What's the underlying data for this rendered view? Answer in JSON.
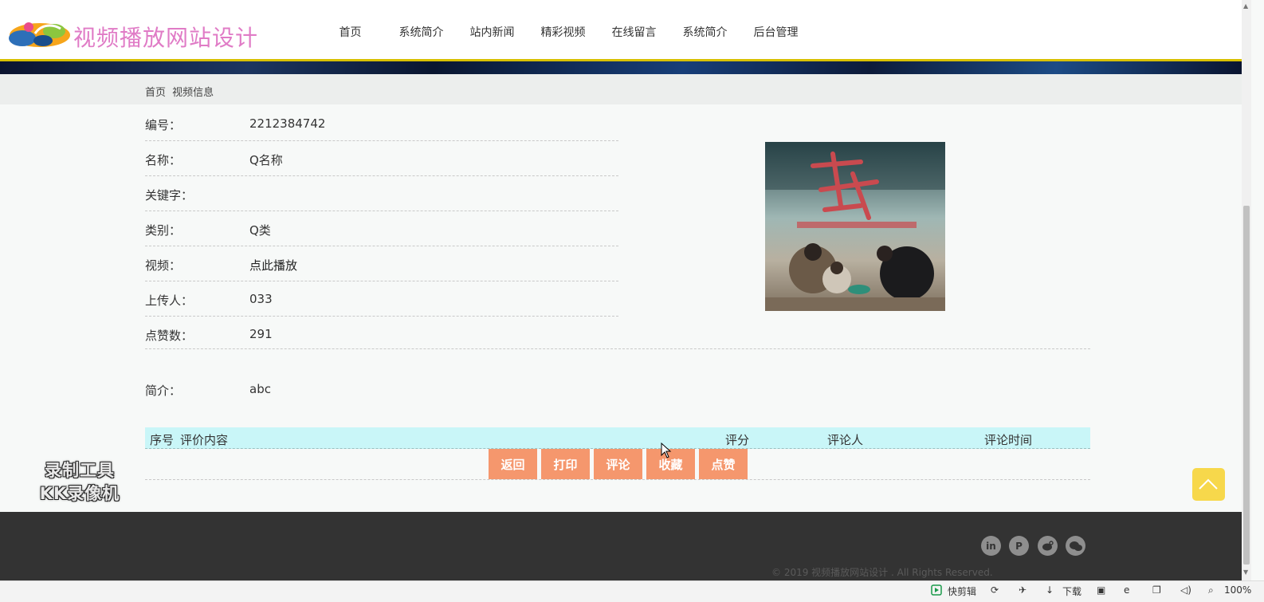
{
  "header": {
    "site_title": "视频播放网站设计",
    "nav": [
      "首页",
      "系统简介",
      "站内新闻",
      "精彩视频",
      "在线留言",
      "系统简介",
      "后台管理"
    ]
  },
  "breadcrumb": [
    "首页",
    "视频信息"
  ],
  "video": {
    "fields": [
      {
        "label": "编号：",
        "value": "2212384742"
      },
      {
        "label": "名称：",
        "value": "Q名称"
      },
      {
        "label": "关键字：",
        "value": ""
      },
      {
        "label": "类别：",
        "value": "Q类"
      },
      {
        "label": "视频：",
        "value": "点此播放"
      },
      {
        "label": "上传人：",
        "value": "033"
      },
      {
        "label": "点赞数：",
        "value": "291"
      }
    ],
    "intro_label": "简介：",
    "intro_value": "abc"
  },
  "comments_table": {
    "headers": [
      "序号",
      "评价内容",
      "评分",
      "评论人",
      "评论时间"
    ]
  },
  "actions": [
    "返回",
    "打印",
    "评论",
    "收藏",
    "点赞"
  ],
  "watermark": {
    "line1": "录制工具",
    "line2": "KK录像机"
  },
  "footer": {
    "social_icons": [
      "linkedin-icon",
      "pinterest-icon",
      "weibo-icon",
      "wechat-icon"
    ],
    "copyright": "© 2019 视频播放网站设计 . All Rights Reserved."
  },
  "statusbar": {
    "items": [
      "快剪辑",
      "下载",
      "100%"
    ]
  },
  "colors": {
    "title_pink": "#e07bc6",
    "button_orange": "#f5976d",
    "table_header": "#c9f6f8",
    "footer_bg": "#333333",
    "gold_line": "#d8c000"
  }
}
